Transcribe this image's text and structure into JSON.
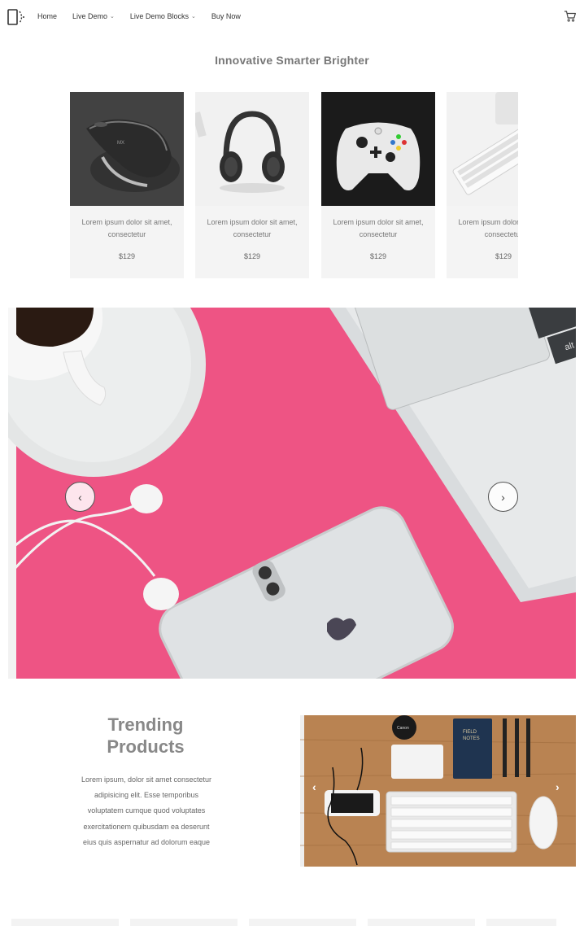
{
  "nav": {
    "items": [
      {
        "label": "Home",
        "has_dropdown": false
      },
      {
        "label": "Live Demo",
        "has_dropdown": true
      },
      {
        "label": "Live Demo Blocks",
        "has_dropdown": true
      },
      {
        "label": "Buy Now",
        "has_dropdown": false
      }
    ],
    "cart_icon": "cart-icon",
    "logo_icon": "device-logo-icon"
  },
  "featured": {
    "title": "Innovative Smarter Brighter",
    "products": [
      {
        "name": "Lorem ipsum dolor sit amet, consectetur",
        "price": "$129",
        "image": "mouse"
      },
      {
        "name": "Lorem ipsum dolor sit amet, consectetur",
        "price": "$129",
        "image": "headphones"
      },
      {
        "name": "Lorem ipsum dolor sit amet, consectetur",
        "price": "$129",
        "image": "gamepad"
      },
      {
        "name": "Lorem ipsum dolor sit amet, consectetur",
        "price": "$129",
        "image": "keyboard"
      }
    ]
  },
  "hero": {
    "prev_icon": "chevron-left-icon",
    "next_icon": "chevron-right-icon",
    "prev_glyph": "‹",
    "next_glyph": "›",
    "background_color": "#ee5484"
  },
  "trending": {
    "title_line1": "Trending",
    "title_line2": "Products",
    "text": "Lorem ipsum, dolor sit amet consectetur adipisicing elit. Esse temporibus voluptatem cumque quod voluptates exercitationem quibusdam ea deserunt eius quis aspernatur ad dolorum eaque",
    "notebook_label_1": "FIELD",
    "notebook_label_2": "NOTES",
    "lens_cap_label": "Canon",
    "prev_glyph": "‹",
    "next_glyph": "›"
  }
}
